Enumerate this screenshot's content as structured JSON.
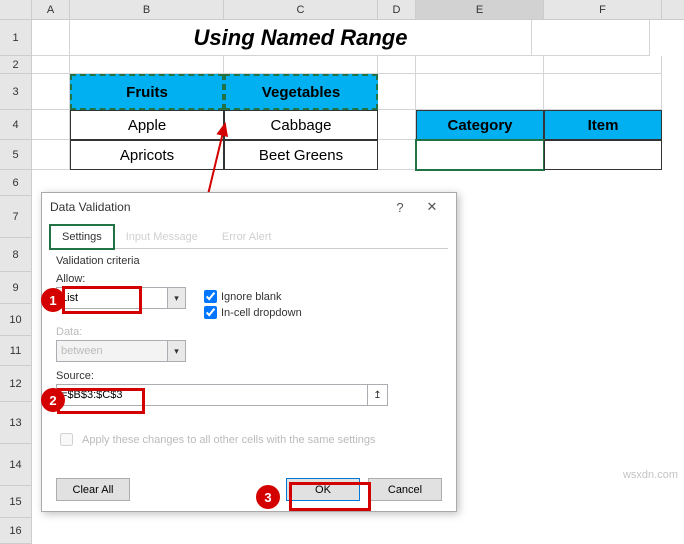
{
  "columns": [
    "A",
    "B",
    "C",
    "D",
    "E",
    "F"
  ],
  "rows": [
    "1",
    "2",
    "3",
    "4",
    "5",
    "6",
    "7",
    "8",
    "9",
    "10",
    "11",
    "12",
    "13",
    "14",
    "15",
    "16"
  ],
  "title": "Using Named Range",
  "table1": {
    "h1": "Fruits",
    "h2": "Vegetables",
    "r1c1": "Apple",
    "r1c2": "Cabbage",
    "r2c1": "Apricots",
    "r2c2": "Beet Greens"
  },
  "table2": {
    "h1": "Category",
    "h2": "Item"
  },
  "dialog": {
    "title": "Data Validation",
    "help": "?",
    "close": "✕",
    "tabs": {
      "settings": "Settings",
      "input": "Input Message",
      "error": "Error Alert"
    },
    "criteria_label": "Validation criteria",
    "allow_label": "Allow:",
    "allow_value": "List",
    "data_label": "Data:",
    "data_value": "between",
    "ignore_blank": "Ignore blank",
    "incell": "In-cell dropdown",
    "source_label": "Source:",
    "source_value": "=$B$3:$C$3",
    "apply": "Apply these changes to all other cells with the same settings",
    "clear": "Clear All",
    "ok": "OK",
    "cancel": "Cancel"
  },
  "watermark": "wsxdn.com"
}
